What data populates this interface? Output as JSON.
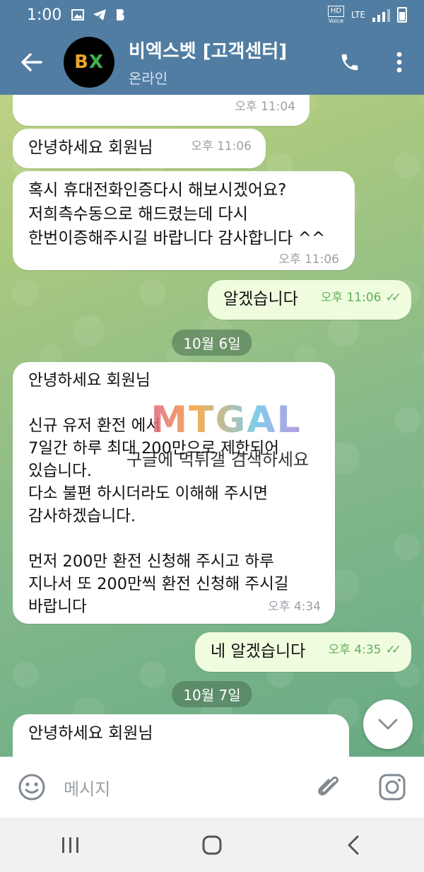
{
  "status_bar": {
    "time": "1:00",
    "hd_label": "HD",
    "voice_label": "Voice",
    "lte_label": "LTE"
  },
  "header": {
    "title": "비엑스벳 [고객센터]",
    "subtitle": "온라인",
    "avatar_text": "BX"
  },
  "messages": [
    {
      "id": "m0",
      "direction": "in",
      "text": "",
      "time": "오후 11:04"
    },
    {
      "id": "m1",
      "direction": "in",
      "text": "안녕하세요 회원님",
      "time": "오후 11:06"
    },
    {
      "id": "m2",
      "direction": "in",
      "text": "혹시 휴대전화인증다시 해보시겠어요?\n저희측수동으로 해드렸는데 다시\n한번이증해주시길 바랍니다 감사합니다 ^^",
      "time": "오후 11:06"
    },
    {
      "id": "m3",
      "direction": "out",
      "text": "알겠습니다",
      "time": "오후 11:06"
    },
    {
      "id": "m4",
      "direction": "in",
      "text": "안녕하세요 회원님\n\n신규 유저 환전 ​​​​​​​​​​​​​​​​​에서\n7일간 하루 최대 200만으로 제한되어\n있습니다.\n다소 불편 하시더라도 이해해 주시면\n감사하겠습니다.\n\n먼저 200만 환전 신청해 주시고 하루\n지나서 또 200만씩 환전 신청해 주시길\n바랍니다",
      "time": "오후 4:34"
    },
    {
      "id": "m5",
      "direction": "out",
      "text": "네 알겠습니다",
      "time": "오후 4:35"
    },
    {
      "id": "m6",
      "direction": "in",
      "text": "안녕하세요 회원님",
      "time": ""
    }
  ],
  "date_chips": [
    "10월 6일",
    "10월 7일"
  ],
  "watermark": {
    "logo": "MTGAL",
    "text": "구글에 먹튀갤 검색하세요"
  },
  "input": {
    "placeholder": "메시지"
  },
  "icons": {
    "back": "arrow-left-icon",
    "call": "phone-icon",
    "menu": "more-vert-icon",
    "emoji": "emoji-icon",
    "attach": "paperclip-icon",
    "camera": "instagram-camera-icon",
    "scroll": "chevron-down-icon"
  },
  "colors": {
    "header": "#517da2",
    "outgoing_bubble": "#effdde",
    "read_check": "#5fae5f"
  }
}
